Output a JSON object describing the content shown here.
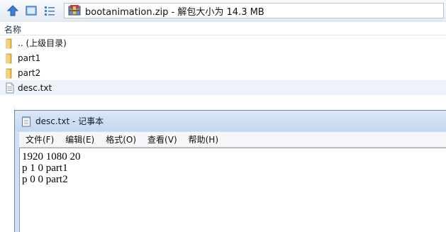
{
  "explorer": {
    "address_text": "bootanimation.zip - 解包大小为 14.3 MB",
    "column_name_header": "名称",
    "files": [
      {
        "name": ".. (上级目录)",
        "icon": "parent-folder-icon",
        "type": "folder"
      },
      {
        "name": "part1",
        "icon": "folder-icon",
        "type": "folder"
      },
      {
        "name": "part2",
        "icon": "folder-icon",
        "type": "folder"
      },
      {
        "name": "desc.txt",
        "icon": "text-file-icon",
        "type": "file"
      }
    ],
    "toolbar_icons": [
      "up-arrow-icon",
      "view-icon",
      "list-view-icon"
    ]
  },
  "notepad": {
    "title": "desc.txt - 记事本",
    "menu": [
      "文件(F)",
      "编辑(E)",
      "格式(O)",
      "查看(V)",
      "帮助(H)"
    ],
    "content_lines": [
      "1920 1080 20",
      "p 1 0 part1",
      "p 0 0 part2"
    ]
  },
  "colors": {
    "folder": "#e8b84a",
    "accent": "#3d7fd6",
    "title_bar": "#c9dcf1"
  }
}
